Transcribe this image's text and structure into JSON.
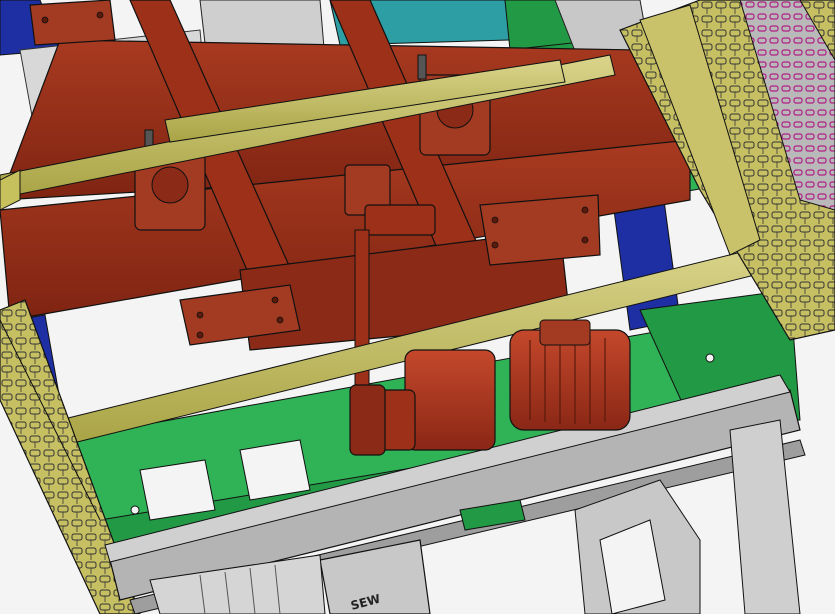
{
  "window": {
    "title": ""
  },
  "model": {
    "motor_brand": "SEW",
    "colors": {
      "frame_red": "#8b2a17",
      "frame_red_light": "#a33a22",
      "rail_yellow": "#c6c15c",
      "chain_yellow": "#c9c26a",
      "base_green": "#229944",
      "base_green_light": "#2fb356",
      "column_blue": "#1e2fa4",
      "beam_gray": "#b4b4b4",
      "beam_gray_dark": "#8c8c8c",
      "accent_teal": "#2d9ea3",
      "accent_magenta": "#b01e86",
      "outline": "#1a1a1a",
      "background": "#f4f4f4"
    },
    "components": [
      {
        "name": "lift-frame",
        "label": ""
      },
      {
        "name": "pillow-block-bearing",
        "label": ""
      },
      {
        "name": "geared-motor",
        "label": "SEW"
      },
      {
        "name": "chain-conveyor",
        "label": ""
      },
      {
        "name": "support-column",
        "label": ""
      },
      {
        "name": "base-frame",
        "label": ""
      },
      {
        "name": "guide-rail",
        "label": ""
      }
    ]
  }
}
